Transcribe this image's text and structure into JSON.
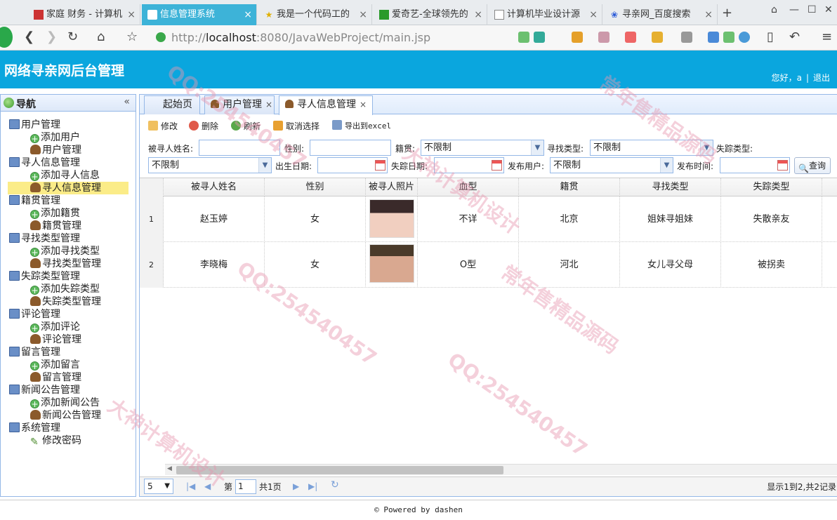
{
  "browser": {
    "tabs": [
      {
        "label": "家庭 财务 - 计算机",
        "icon": "red-square-icon"
      },
      {
        "label": "信息管理系统",
        "icon": "page-icon"
      },
      {
        "label": "我是一个代码工的",
        "icon": "star-icon"
      },
      {
        "label": "爱奇艺-全球领先的",
        "icon": "iqiyi-icon"
      },
      {
        "label": "计算机毕业设计源",
        "icon": "page-icon"
      },
      {
        "label": "寻亲网_百度搜索",
        "icon": "baidu-paw-icon"
      }
    ],
    "new_tab": "+",
    "url_prefix": "http://",
    "url_host": "localhost",
    "url_rest": ":8080/JavaWebProject/main.jsp"
  },
  "header": {
    "title": "网络寻亲网后台管理",
    "greeting": "您好，a",
    "separator": "|",
    "logout": "退出"
  },
  "sidebar": {
    "title": "导航",
    "collapse": "«",
    "groups": [
      {
        "label": "用户管理",
        "items": [
          {
            "label": "添加用户",
            "icon": "add"
          },
          {
            "label": "用户管理",
            "icon": "user"
          }
        ]
      },
      {
        "label": "寻人信息管理",
        "items": [
          {
            "label": "添加寻人信息",
            "icon": "add"
          },
          {
            "label": "寻人信息管理",
            "icon": "user",
            "selected": true
          }
        ]
      },
      {
        "label": "籍贯管理",
        "items": [
          {
            "label": "添加籍贯",
            "icon": "add"
          },
          {
            "label": "籍贯管理",
            "icon": "user"
          }
        ]
      },
      {
        "label": "寻找类型管理",
        "items": [
          {
            "label": "添加寻找类型",
            "icon": "add"
          },
          {
            "label": "寻找类型管理",
            "icon": "user"
          }
        ]
      },
      {
        "label": "失踪类型管理",
        "items": [
          {
            "label": "添加失踪类型",
            "icon": "add"
          },
          {
            "label": "失踪类型管理",
            "icon": "user"
          }
        ]
      },
      {
        "label": "评论管理",
        "items": [
          {
            "label": "添加评论",
            "icon": "add"
          },
          {
            "label": "评论管理",
            "icon": "user"
          }
        ]
      },
      {
        "label": "留言管理",
        "items": [
          {
            "label": "添加留言",
            "icon": "add"
          },
          {
            "label": "留言管理",
            "icon": "user"
          }
        ]
      },
      {
        "label": "新闻公告管理",
        "items": [
          {
            "label": "添加新闻公告",
            "icon": "add"
          },
          {
            "label": "新闻公告管理",
            "icon": "user"
          }
        ]
      },
      {
        "label": "系统管理",
        "items": [
          {
            "label": "修改密码",
            "icon": "pen"
          }
        ]
      }
    ]
  },
  "content_tabs": [
    {
      "label": "起始页"
    },
    {
      "label": "用户管理",
      "close": "×"
    },
    {
      "label": "寻人信息管理",
      "close": "×",
      "active": true
    }
  ],
  "toolbar": {
    "edit": "修改",
    "delete": "删除",
    "refresh": "刷新",
    "cancel_select": "取消选择",
    "export": "导出到excel"
  },
  "filters": {
    "name_label": "被寻人姓名:",
    "sex_label": "性别:",
    "native_label": "籍贯:",
    "native_value": "不限制",
    "find_type_label": "寻找类型:",
    "find_type_value": "不限制",
    "lost_type_label": "失踪类型:",
    "lost_type_value": "不限制",
    "birth_label": "出生日期:",
    "lost_date_label": "失踪日期:",
    "publisher_label": "发布用户:",
    "publisher_value": "不限制",
    "publish_time_label": "发布时间:",
    "search_button": "查询"
  },
  "grid": {
    "columns": [
      "被寻人姓名",
      "性别",
      "被寻人照片",
      "血型",
      "籍贯",
      "寻找类型",
      "失踪类型"
    ],
    "rows": [
      {
        "no": "1",
        "name": "赵玉婷",
        "sex": "女",
        "blood": "不详",
        "native": "北京",
        "find_type": "姐妹寻姐妹",
        "lost_type": "失散亲友"
      },
      {
        "no": "2",
        "name": "李晓梅",
        "sex": "女",
        "blood": "O型",
        "native": "河北",
        "find_type": "女儿寻父母",
        "lost_type": "被拐卖"
      }
    ]
  },
  "pager": {
    "page_size": "5",
    "page_prefix": "第",
    "page_no": "1",
    "page_total": "共1页",
    "summary": "显示1到2,共2记录"
  },
  "footer": {
    "text": "© Powered by dashen"
  },
  "watermarks": [
    "QQ:254540457",
    "常年售精品源码",
    "大神计算机设计"
  ],
  "colors": {
    "banner": "#0aa6de",
    "active_tab": "#3db3d8",
    "panel_border": "#95b8e7",
    "selected_node": "#fbec88"
  }
}
